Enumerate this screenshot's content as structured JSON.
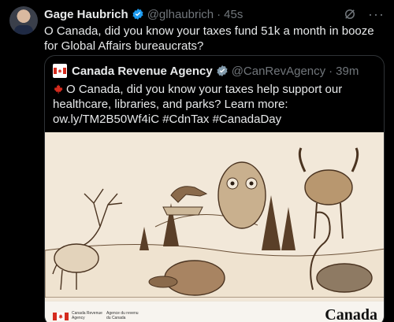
{
  "tweet": {
    "author_name": "Gage Haubrich",
    "handle": "@glhaubrich",
    "separator": "·",
    "time": "45s",
    "text": "O Canada, did you know your taxes fund 51k a month in booze for Global Affairs bureaucrats?",
    "icons": [
      "avatar",
      "verified-badge-icon",
      "grok-icon",
      "more-icon"
    ]
  },
  "quoted": {
    "author_name": "Canada Revenue Agency",
    "handle": "@CanRevAgency",
    "separator": "·",
    "time": "39m",
    "text": "O Canada, did you know your taxes help support our healthcare, libraries, and parks? Learn more: ow.ly/TM2B50Wf4iC #CdnTax #CanadaDay",
    "image": {
      "footer_en": "Canada Revenue Agency",
      "footer_fr": "Agence du revenu du Canada",
      "wordmark": "Canada"
    }
  },
  "colors": {
    "background": "#000000",
    "text": "#e7e9ea",
    "muted": "#71767b",
    "verified": "#1d9bf0",
    "border": "#2f3336",
    "canada_red": "#d52b1e"
  }
}
